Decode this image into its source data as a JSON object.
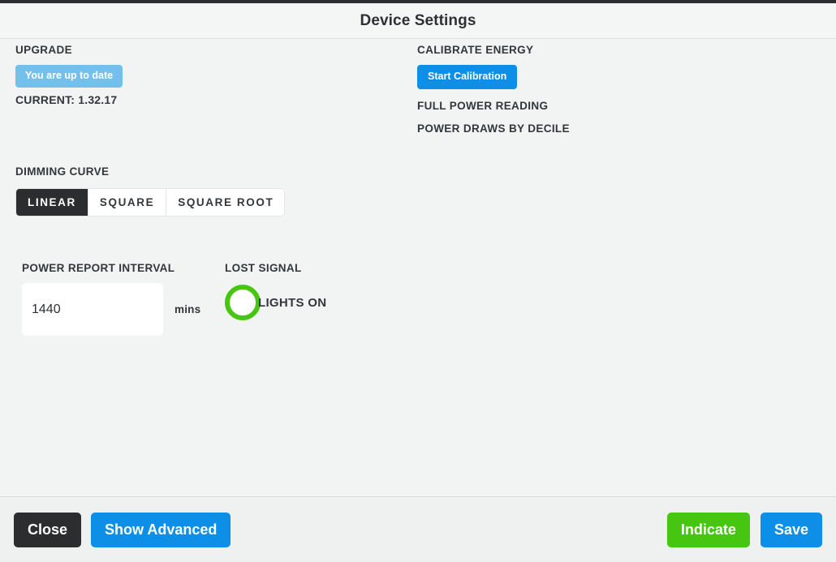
{
  "header": {
    "title": "Device Settings"
  },
  "upgrade": {
    "label": "UPGRADE",
    "status_badge": "You are up to date",
    "current_version": "CURRENT: 1.32.17",
    "badge_color": "#74c0ec"
  },
  "calibrate": {
    "label": "CALIBRATE ENERGY",
    "start_button": "Start Calibration",
    "full_power_reading": "FULL POWER READING",
    "power_draws_by_decile": "POWER DRAWS BY DECILE",
    "button_color": "#0d8fe8"
  },
  "dimming_curve": {
    "label": "DIMMING CURVE",
    "options": [
      "LINEAR",
      "SQUARE",
      "SQUARE ROOT"
    ],
    "selected": "LINEAR"
  },
  "power_report_interval": {
    "label": "POWER REPORT INTERVAL",
    "value": "1440",
    "placeholder": "",
    "unit": "mins"
  },
  "lost_signal": {
    "label": "LOST SIGNAL",
    "state_label": "LIGHTS ON",
    "indicator_color": "#46c511"
  },
  "footer": {
    "close_label": "Close",
    "show_advanced_label": "Show Advanced",
    "indicate_label": "Indicate",
    "save_label": "Save"
  }
}
